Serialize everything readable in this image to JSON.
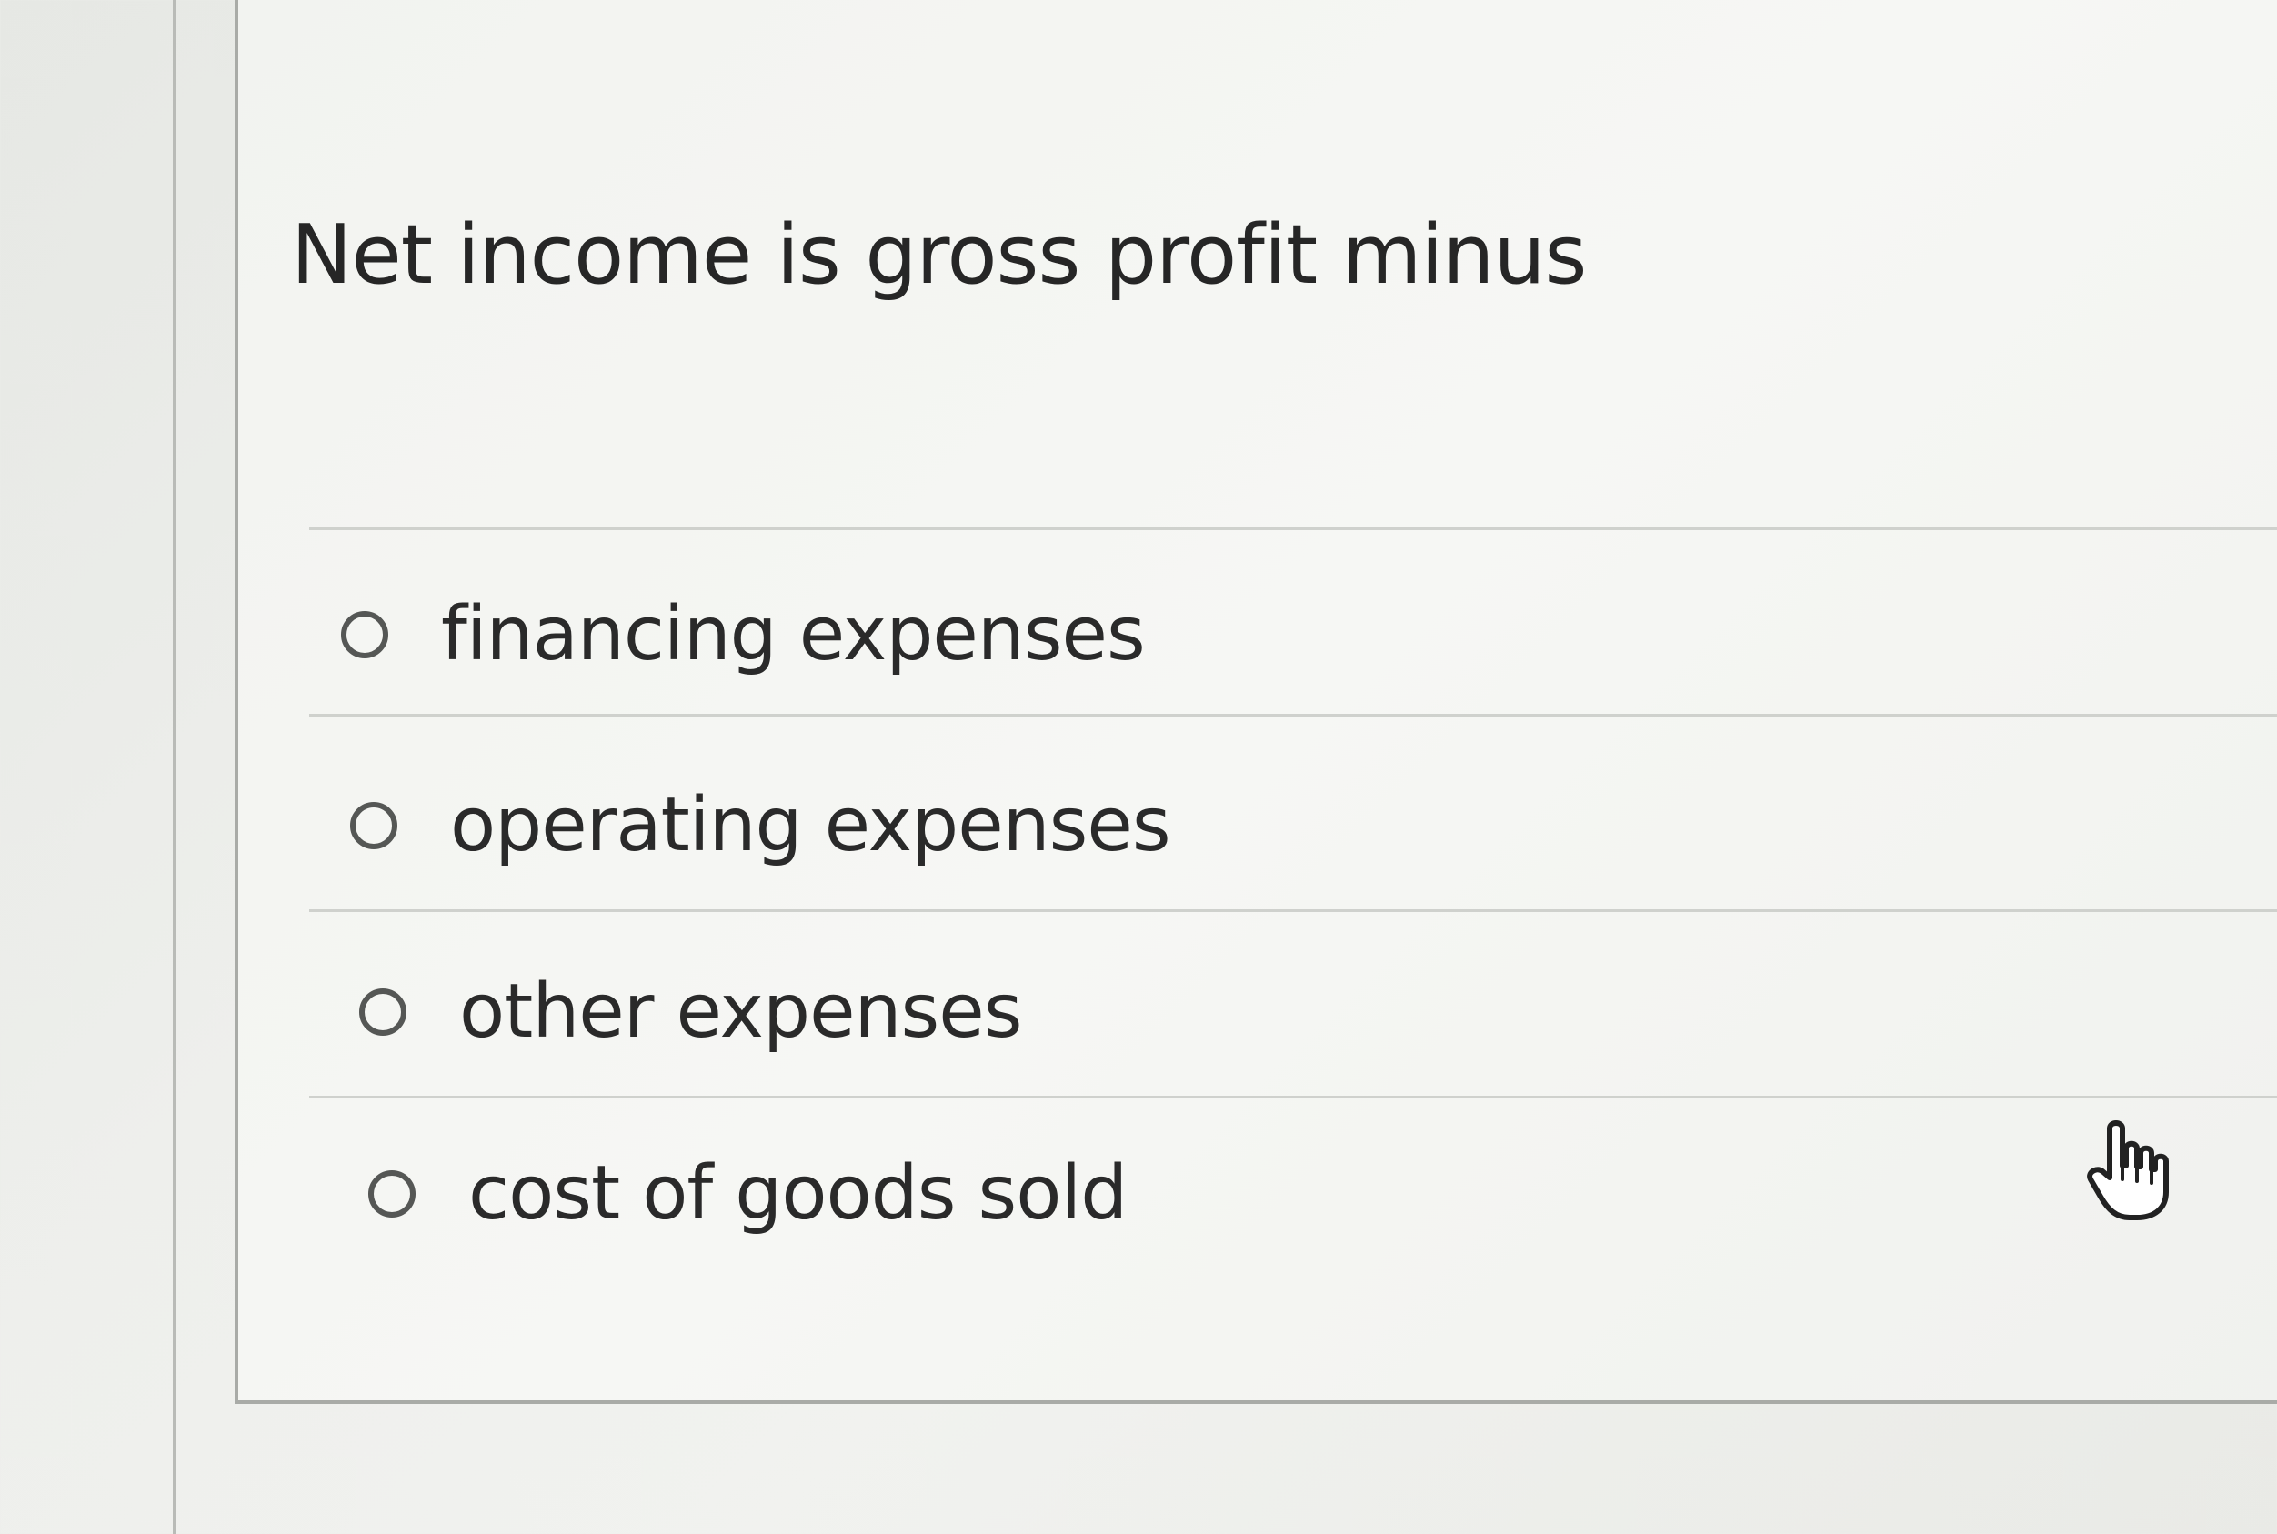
{
  "question": {
    "text": "Net income is gross profit minus"
  },
  "options": [
    {
      "label": "financing expenses",
      "selected": false
    },
    {
      "label": "operating expenses",
      "selected": false
    },
    {
      "label": "other expenses",
      "selected": false
    },
    {
      "label": "cost of goods sold",
      "selected": false
    }
  ],
  "cursor": {
    "icon": "hand-pointer-icon"
  },
  "colors": {
    "background": "#eeefec",
    "text": "#262626",
    "radio_border": "#555755",
    "divider": "#cfd1cd"
  }
}
